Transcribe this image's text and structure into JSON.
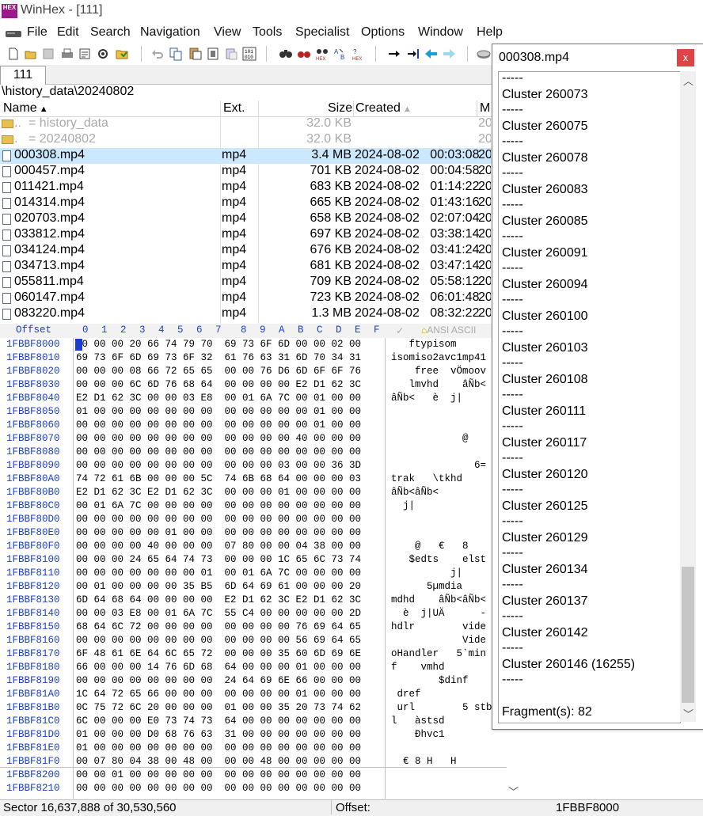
{
  "window": {
    "title": "WinHex - [111]",
    "icon_name": "winhex-logo-icon",
    "icon_text": "HEX"
  },
  "menu": [
    "File",
    "Edit",
    "Search",
    "Navigation",
    "View",
    "Tools",
    "Specialist",
    "Options",
    "Window",
    "Help"
  ],
  "toolbar_icons": [
    "new-file-icon",
    "open-icon",
    "save-icon",
    "print-icon",
    "properties-icon",
    "settings-icon",
    "open-folder-icon",
    "undo-icon",
    "copy-icon",
    "paste-icon",
    "paste-special-icon",
    "clipboard-icon",
    "find-icon",
    "find-hex-icon",
    "replace-hex-icon",
    "replace-icon",
    "find-hex-value-icon",
    "go-to-offset-icon",
    "go-to-sector-icon",
    "back-icon",
    "forward-icon",
    "disk-icon"
  ],
  "tabs": [
    {
      "label": "111"
    }
  ],
  "path": "\\history_data\\20240802",
  "file_list": {
    "columns": {
      "name": "Name",
      "ext": "Ext.",
      "size": "Size",
      "created": "Created",
      "modified": "M"
    },
    "parent_rows": [
      {
        "name": "..",
        "label": "=   history_data",
        "size": "32.0 KB",
        "mod": "20"
      },
      {
        "name": ".",
        "label": "=   20240802",
        "size": "32.0 KB",
        "mod": "20"
      }
    ],
    "rows": [
      {
        "name": "000308.mp4",
        "ext": "mp4",
        "size": "3.4 MB",
        "date": "2024-08-02",
        "time": "00:03:08",
        "mod": "20",
        "selected": true
      },
      {
        "name": "000457.mp4",
        "ext": "mp4",
        "size": "701 KB",
        "date": "2024-08-02",
        "time": "00:04:58",
        "mod": "20"
      },
      {
        "name": "011421.mp4",
        "ext": "mp4",
        "size": "683 KB",
        "date": "2024-08-02",
        "time": "01:14:22",
        "mod": "20"
      },
      {
        "name": "014314.mp4",
        "ext": "mp4",
        "size": "665 KB",
        "date": "2024-08-02",
        "time": "01:43:16",
        "mod": "20"
      },
      {
        "name": "020703.mp4",
        "ext": "mp4",
        "size": "658 KB",
        "date": "2024-08-02",
        "time": "02:07:04",
        "mod": "20"
      },
      {
        "name": "033812.mp4",
        "ext": "mp4",
        "size": "697 KB",
        "date": "2024-08-02",
        "time": "03:38:14",
        "mod": "20"
      },
      {
        "name": "034124.mp4",
        "ext": "mp4",
        "size": "676 KB",
        "date": "2024-08-02",
        "time": "03:41:24",
        "mod": "20"
      },
      {
        "name": "034713.mp4",
        "ext": "mp4",
        "size": "681 KB",
        "date": "2024-08-02",
        "time": "03:47:14",
        "mod": "20"
      },
      {
        "name": "055811.mp4",
        "ext": "mp4",
        "size": "709 KB",
        "date": "2024-08-02",
        "time": "05:58:12",
        "mod": "20"
      },
      {
        "name": "060147.mp4",
        "ext": "mp4",
        "size": "723 KB",
        "date": "2024-08-02",
        "time": "06:01:48",
        "mod": "20"
      },
      {
        "name": "083220.mp4",
        "ext": "mp4",
        "size": "1.3 MB",
        "date": "2024-08-02",
        "time": "08:32:22",
        "mod": "20"
      }
    ]
  },
  "hex": {
    "header_offset": "Offset",
    "columns": [
      "0",
      "1",
      "2",
      "3",
      "4",
      "5",
      "6",
      "7",
      "8",
      "9",
      "A",
      "B",
      "C",
      "D",
      "E",
      "F"
    ],
    "text_header": "ANSI ASCII",
    "rows": [
      {
        "offset": "1FBBF8000",
        "bytes": "00 00 00 20 66 74 79 70  69 73 6F 6D 00 00 02 00",
        "text": "   ftypisom"
      },
      {
        "offset": "1FBBF8010",
        "bytes": "69 73 6F 6D 69 73 6F 32  61 76 63 31 6D 70 34 31",
        "text": "isomiso2avc1mp41"
      },
      {
        "offset": "1FBBF8020",
        "bytes": "00 00 00 08 66 72 65 65  00 00 76 D6 6D 6F 6F 76",
        "text": "    free  vÖmoov"
      },
      {
        "offset": "1FBBF8030",
        "bytes": "00 00 00 6C 6D 76 68 64  00 00 00 00 E2 D1 62 3C",
        "text": "   lmvhd    âÑb<"
      },
      {
        "offset": "1FBBF8040",
        "bytes": "E2 D1 62 3C 00 00 03 E8  00 01 6A 7C 00 01 00 00",
        "text": "âÑb<   è  j|"
      },
      {
        "offset": "1FBBF8050",
        "bytes": "01 00 00 00 00 00 00 00  00 00 00 00 00 01 00 00",
        "text": ""
      },
      {
        "offset": "1FBBF8060",
        "bytes": "00 00 00 00 00 00 00 00  00 00 00 00 00 01 00 00",
        "text": ""
      },
      {
        "offset": "1FBBF8070",
        "bytes": "00 00 00 00 00 00 00 00  00 00 00 00 40 00 00 00",
        "text": "            @"
      },
      {
        "offset": "1FBBF8080",
        "bytes": "00 00 00 00 00 00 00 00  00 00 00 00 00 00 00 00",
        "text": ""
      },
      {
        "offset": "1FBBF8090",
        "bytes": "00 00 00 00 00 00 00 00  00 00 00 03 00 00 36 3D",
        "text": "              6="
      },
      {
        "offset": "1FBBF80A0",
        "bytes": "74 72 61 6B 00 00 00 5C  74 6B 68 64 00 00 00 03",
        "text": "trak   \\tkhd"
      },
      {
        "offset": "1FBBF80B0",
        "bytes": "E2 D1 62 3C E2 D1 62 3C  00 00 00 01 00 00 00 00",
        "text": "âÑb<âÑb<"
      },
      {
        "offset": "1FBBF80C0",
        "bytes": "00 01 6A 7C 00 00 00 00  00 00 00 00 00 00 00 00",
        "text": "  j|"
      },
      {
        "offset": "1FBBF80D0",
        "bytes": "00 00 00 00 00 00 00 00  00 00 00 00 00 00 00 00",
        "text": ""
      },
      {
        "offset": "1FBBF80E0",
        "bytes": "00 00 00 00 00 01 00 00  00 00 00 00 00 00 00 00",
        "text": ""
      },
      {
        "offset": "1FBBF80F0",
        "bytes": "00 00 00 00 40 00 00 00  07 80 00 00 04 38 00 00",
        "text": "    @   €   8"
      },
      {
        "offset": "1FBBF8100",
        "bytes": "00 00 00 24 65 64 74 73  00 00 00 1C 65 6C 73 74",
        "text": "   $edts    elst"
      },
      {
        "offset": "1FBBF8110",
        "bytes": "00 00 00 00 00 00 00 01  00 01 6A 7C 00 00 00 00",
        "text": "          j|"
      },
      {
        "offset": "1FBBF8120",
        "bytes": "00 01 00 00 00 00 35 B5  6D 64 69 61 00 00 00 20",
        "text": "      5µmdia"
      },
      {
        "offset": "1FBBF8130",
        "bytes": "6D 64 68 64 00 00 00 00  E2 D1 62 3C E2 D1 62 3C",
        "text": "mdhd    âÑb<âÑb<"
      },
      {
        "offset": "1FBBF8140",
        "bytes": "00 00 03 E8 00 01 6A 7C  55 C4 00 00 00 00 00 2D",
        "text": "  è  j|UÄ      -"
      },
      {
        "offset": "1FBBF8150",
        "bytes": "68 64 6C 72 00 00 00 00  00 00 00 00 76 69 64 65",
        "text": "hdlr        vide"
      },
      {
        "offset": "1FBBF8160",
        "bytes": "00 00 00 00 00 00 00 00  00 00 00 00 56 69 64 65",
        "text": "            Vide"
      },
      {
        "offset": "1FBBF8170",
        "bytes": "6F 48 61 6E 64 6C 65 72  00 00 00 35 60 6D 69 6E",
        "text": "oHandler   5`min"
      },
      {
        "offset": "1FBBF8180",
        "bytes": "66 00 00 00 14 76 6D 68  64 00 00 00 01 00 00 00",
        "text": "f    vmhd"
      },
      {
        "offset": "1FBBF8190",
        "bytes": "00 00 00 00 00 00 00 00  24 64 69 6E 66 00 00 00",
        "text": "        $dinf"
      },
      {
        "offset": "1FBBF81A0",
        "bytes": "1C 64 72 65 66 00 00 00  00 00 00 00 01 00 00 00",
        "text": " dref"
      },
      {
        "offset": "1FBBF81B0",
        "bytes": "0C 75 72 6C 20 00 00 00  01 00 00 35 20 73 74 62",
        "text": " url        5 stb"
      },
      {
        "offset": "1FBBF81C0",
        "bytes": "6C 00 00 00 E0 73 74 73  64 00 00 00 00 00 00 00",
        "text": "l   àstsd"
      },
      {
        "offset": "1FBBF81D0",
        "bytes": "01 00 00 00 D0 68 76 63  31 00 00 00 00 00 00 00",
        "text": "    Ðhvc1"
      },
      {
        "offset": "1FBBF81E0",
        "bytes": "01 00 00 00 00 00 00 00  00 00 00 00 00 00 00 00",
        "text": ""
      },
      {
        "offset": "1FBBF81F0",
        "bytes": "00 07 80 04 38 00 48 00  00 00 48 00 00 00 00 00",
        "text": "  € 8 H   H"
      },
      {
        "offset": "1FBBF8200",
        "bytes": "00 00 01 00 00 00 00 00  00 00 00 00 00 00 00 00",
        "text": ""
      },
      {
        "offset": "1FBBF8210",
        "bytes": "00 00 00 00 00 00 00 00  00 00 00 00 00 00 00 00",
        "text": ""
      }
    ]
  },
  "status": {
    "sector": "Sector 16,637,888 of 30,530,560",
    "offset_label": "Offset:",
    "offset_value": "1FBBF8000"
  },
  "popup": {
    "title": "000308.mp4",
    "close_label": "x",
    "separator": "-----",
    "clusters": [
      "Cluster 260073",
      "Cluster 260075",
      "Cluster 260078",
      "Cluster 260083",
      "Cluster 260085",
      "Cluster 260091",
      "Cluster 260094",
      "Cluster 260100",
      "Cluster 260103",
      "Cluster 260108",
      "Cluster 260111",
      "Cluster 260117",
      "Cluster 260120",
      "Cluster 260125",
      "Cluster 260129",
      "Cluster 260134",
      "Cluster 260137",
      "Cluster 260142",
      "Cluster 260146 (16255)"
    ],
    "fragments": "Fragment(s):  82"
  },
  "colors": {
    "selected_row": "#cce8ff",
    "offset_blue": "#1a3fd0",
    "close_red": "#e04343"
  }
}
